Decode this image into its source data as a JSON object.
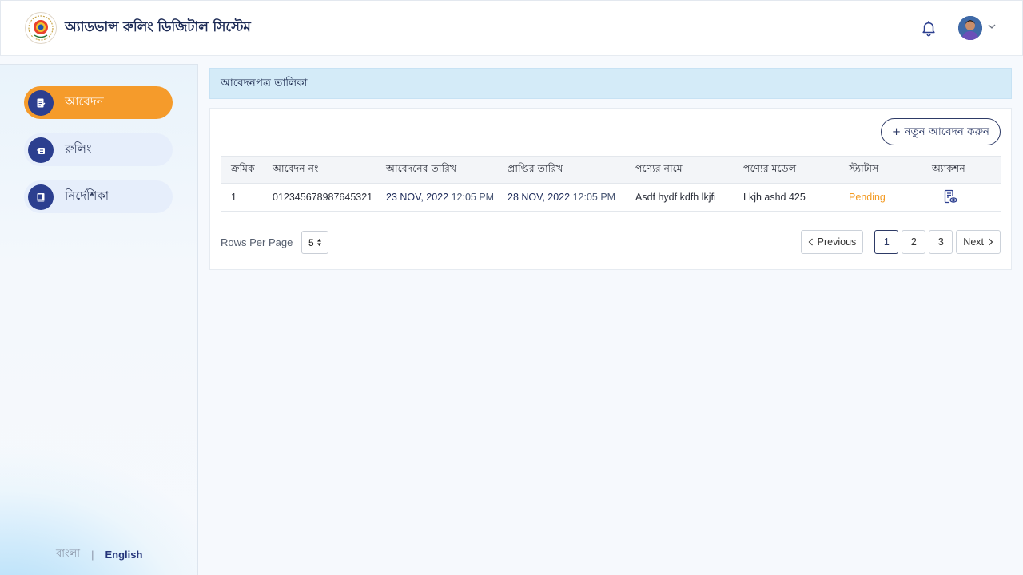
{
  "header": {
    "app_title": "অ্যাডভান্স রুলিং ডিজিটাল সিস্টেম",
    "logo_icon": "emblem-logo",
    "notification_icon": "bell-icon"
  },
  "sidebar": {
    "items": [
      {
        "label": "আবেদন",
        "icon": "document-icon",
        "active": true
      },
      {
        "label": "রুলিং",
        "icon": "ruling-icon",
        "active": false
      },
      {
        "label": "নির্দেশিকা",
        "icon": "book-icon",
        "active": false
      }
    ],
    "lang_bn": "বাংলা",
    "lang_sep": "|",
    "lang_en": "English"
  },
  "main": {
    "page_title": "আবেদনপত্র তালিকা",
    "new_button": "+ নতুন আবেদন করুন",
    "table": {
      "headers": [
        "ক্রমিক",
        "আবেদন নং",
        "আবেদনের তারিখ",
        "প্রাপ্তির তারিখ",
        "পণ্যের নামে",
        "পণ্যের মডেল",
        "স্ট্যাটাস",
        "অ্যাকশন"
      ],
      "rows": [
        {
          "serial": "1",
          "app_no": "012345678987645321",
          "app_date": "23 NOV, 2022",
          "app_time": "12:05 PM",
          "recv_date": "28 NOV, 2022",
          "recv_time": "12:05 PM",
          "product_name": "Asdf hydf kdfh lkjfi",
          "product_model": "Lkjh ashd 425",
          "status": "Pending",
          "action_icon": "view-document-icon"
        }
      ]
    },
    "rows_per_page_label": "Rows Per Page",
    "rows_per_page_value": "5",
    "pagination": {
      "previous": "Previous",
      "pages": [
        "1",
        "2",
        "3"
      ],
      "current": "1",
      "next": "Next"
    }
  },
  "colors": {
    "accent": "#f59b2b",
    "primary": "#2c3f8f",
    "status_pending": "#f39a22",
    "page_head_bg": "#d4ebf8"
  }
}
